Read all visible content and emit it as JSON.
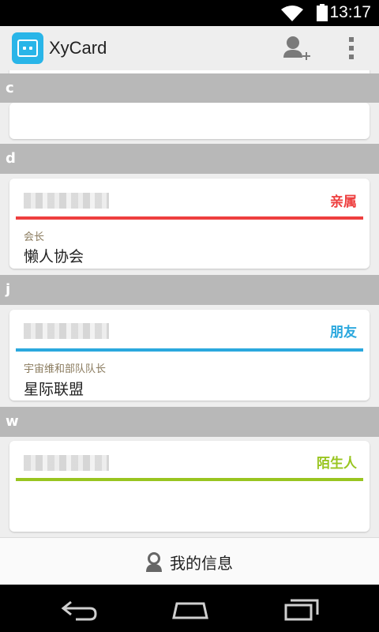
{
  "status_bar": {
    "time": "13:17"
  },
  "app": {
    "title": "XyCard"
  },
  "sections": [
    {
      "letter": "c"
    },
    {
      "letter": "d"
    },
    {
      "letter": "j"
    },
    {
      "letter": "w"
    }
  ],
  "cards": [
    {
      "category": "亲属",
      "role": "会长",
      "org": "懒人协会",
      "color": "#ee3f3f"
    },
    {
      "category": "朋友",
      "role": "宇宙维和部队队长",
      "org": "星际联盟",
      "color": "#2ba8de"
    },
    {
      "category": "陌生人",
      "color": "#99c520"
    }
  ],
  "bottom_bar": {
    "my_info_label": "我的信息"
  }
}
